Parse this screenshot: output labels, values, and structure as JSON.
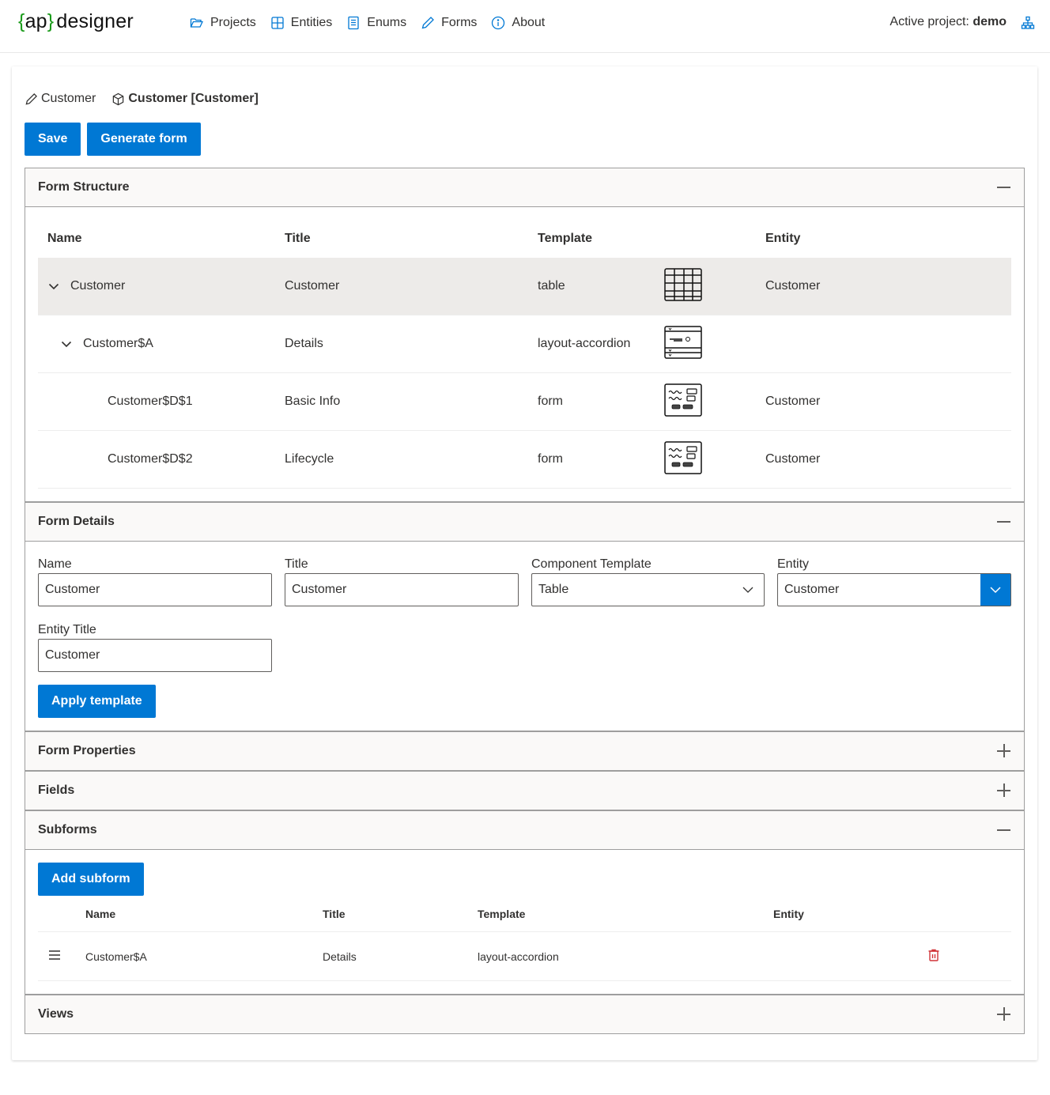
{
  "app": {
    "logo_open": "{",
    "logo_ap": "ap",
    "logo_close": "}",
    "logo_rest": "designer"
  },
  "nav": {
    "items": [
      {
        "label": "Projects",
        "icon": "folder-open-icon"
      },
      {
        "label": "Entities",
        "icon": "grid-icon"
      },
      {
        "label": "Enums",
        "icon": "book-icon"
      },
      {
        "label": "Forms",
        "icon": "pencil-icon"
      },
      {
        "label": "About",
        "icon": "info-icon"
      }
    ],
    "active_project_label": "Active project:",
    "active_project_value": "demo",
    "project_icon": "hierarchy-icon"
  },
  "breadcrumb": {
    "form_name": "Customer",
    "entity_label": "Customer [Customer]"
  },
  "toolbar": {
    "save_label": "Save",
    "generate_label": "Generate form"
  },
  "colors": {
    "accent": "#0078d4",
    "logo_brace": "#1a9b1a",
    "selected_row": "#edebe9",
    "section_header": "#faf9f8",
    "delete": "#d13438"
  },
  "form_structure": {
    "title": "Form Structure",
    "expanded": true,
    "columns": {
      "name": "Name",
      "title": "Title",
      "template": "Template",
      "entity": "Entity"
    },
    "rows": [
      {
        "name": "Customer",
        "title": "Customer",
        "template": "table",
        "template_icon": "table-template-icon",
        "entity": "Customer",
        "level": 0,
        "expandable": true,
        "selected": true
      },
      {
        "name": "Customer$A",
        "title": "Details",
        "template": "layout-accordion",
        "template_icon": "accordion-template-icon",
        "entity": "",
        "level": 1,
        "expandable": true,
        "selected": false
      },
      {
        "name": "Customer$D$1",
        "title": "Basic Info",
        "template": "form",
        "template_icon": "form-template-icon",
        "entity": "Customer",
        "level": 2,
        "expandable": false,
        "selected": false
      },
      {
        "name": "Customer$D$2",
        "title": "Lifecycle",
        "template": "form",
        "template_icon": "form-template-icon",
        "entity": "Customer",
        "level": 2,
        "expandable": false,
        "selected": false
      }
    ]
  },
  "form_details": {
    "title": "Form Details",
    "expanded": true,
    "name_label": "Name",
    "name_value": "Customer",
    "title_label": "Title",
    "title_value": "Customer",
    "template_label": "Component Template",
    "template_value": "Table",
    "entity_label": "Entity",
    "entity_value": "Customer",
    "entity_title_label": "Entity Title",
    "entity_title_value": "Customer",
    "apply_label": "Apply template"
  },
  "form_properties": {
    "title": "Form Properties",
    "expanded": false
  },
  "fields": {
    "title": "Fields",
    "expanded": false
  },
  "subforms": {
    "title": "Subforms",
    "expanded": true,
    "add_label": "Add subform",
    "columns": {
      "name": "Name",
      "title": "Title",
      "template": "Template",
      "entity": "Entity"
    },
    "rows": [
      {
        "name": "Customer$A",
        "title": "Details",
        "template": "layout-accordion",
        "entity": ""
      }
    ]
  },
  "views": {
    "title": "Views",
    "expanded": false
  }
}
